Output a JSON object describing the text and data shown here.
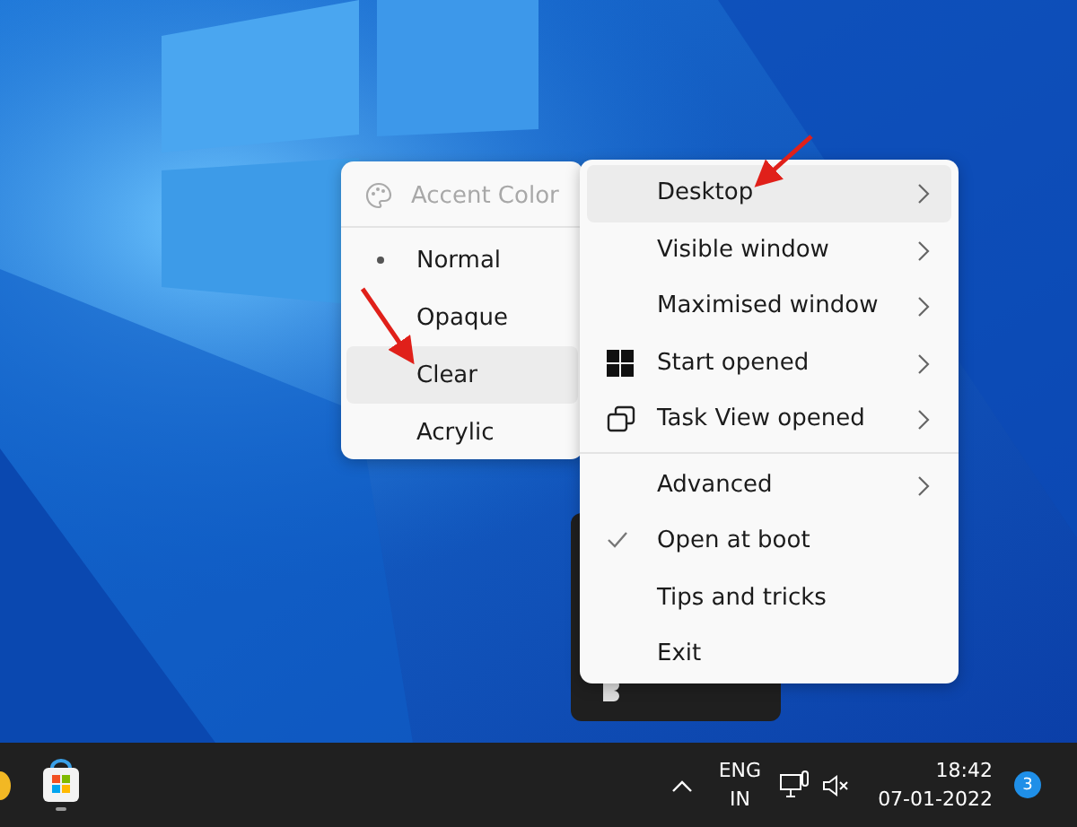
{
  "accent_menu": {
    "header": {
      "label": "Accent Color",
      "disabled": true
    },
    "items": [
      {
        "label": "Normal",
        "selected": true,
        "hovered": false
      },
      {
        "label": "Opaque",
        "selected": false,
        "hovered": false
      },
      {
        "label": "Clear",
        "selected": false,
        "hovered": true
      },
      {
        "label": "Acrylic",
        "selected": false,
        "hovered": false
      }
    ]
  },
  "main_menu": {
    "sections": [
      {
        "items": [
          {
            "label": "Desktop",
            "kind": "plain",
            "submenu": true,
            "checked": false,
            "hovered": true
          },
          {
            "label": "Visible window",
            "kind": "plain",
            "submenu": true,
            "checked": false,
            "hovered": false
          },
          {
            "label": "Maximised window",
            "kind": "plain",
            "submenu": true,
            "checked": false,
            "hovered": false
          },
          {
            "label": "Start opened",
            "kind": "windows",
            "submenu": true,
            "checked": false,
            "hovered": false
          },
          {
            "label": "Task View opened",
            "kind": "taskview",
            "submenu": true,
            "checked": false,
            "hovered": false
          }
        ]
      },
      {
        "items": [
          {
            "label": "Advanced",
            "kind": "plain",
            "submenu": true,
            "checked": false,
            "hovered": false
          },
          {
            "label": "Open at boot",
            "kind": "plain",
            "submenu": false,
            "checked": true,
            "hovered": false
          },
          {
            "label": "Tips and tricks",
            "kind": "plain",
            "submenu": false,
            "checked": false,
            "hovered": false
          },
          {
            "label": "Exit",
            "kind": "plain",
            "submenu": false,
            "checked": false,
            "hovered": false
          }
        ]
      }
    ]
  },
  "taskbar": {
    "tray": {
      "language": [
        "ENG",
        "IN"
      ],
      "time": "18:42",
      "date": "07-01-2022",
      "notifications": "3"
    }
  }
}
